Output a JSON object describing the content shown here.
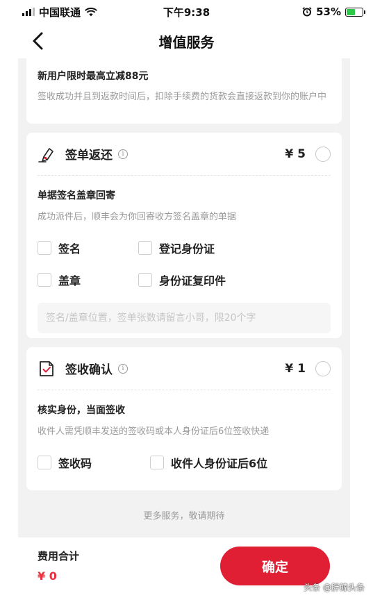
{
  "status_bar": {
    "carrier": "中国联通",
    "time": "下午9:38",
    "battery_percent": "53%",
    "battery_level": 0.53,
    "icons": [
      "signal-icon",
      "wifi-icon",
      "alarm-icon",
      "battery-icon"
    ]
  },
  "nav": {
    "title": "增值服务",
    "back_icon": "chevron-left-icon"
  },
  "promo": {
    "title": "新用户限时最高立减88元",
    "desc": "签收成功并且到返款时间后，扣除手续费的货款会直接返款到你的账户中"
  },
  "sign_return": {
    "name": "签单返还",
    "icon": "pen-sign-icon",
    "price": "¥ 5",
    "selected": false,
    "sub_title": "单据签名盖章回寄",
    "sub_desc": "成功派件后，顺丰会为你回寄收方签名盖章的单据",
    "options": [
      {
        "label": "签名",
        "checked": false
      },
      {
        "label": "登记身份证",
        "checked": false
      },
      {
        "label": "盖章",
        "checked": false
      },
      {
        "label": "身份证复印件",
        "checked": false
      }
    ],
    "note_placeholder": "签名/盖章位置，签单张数请留言小哥，限20个字",
    "note_value": ""
  },
  "sign_confirm": {
    "name": "签收确认",
    "icon": "checked-document-icon",
    "price": "¥ 1",
    "selected": false,
    "sub_title": "核实身份，当面签收",
    "sub_desc": "收件人需凭顺丰发送的签收码或本人身份证后6位签收快递",
    "options": [
      {
        "label": "签收码",
        "checked": false
      },
      {
        "label": "收件人身份证后6位",
        "checked": false
      }
    ]
  },
  "more_hint": "更多服务，敬请期待",
  "footer": {
    "total_label": "费用合计",
    "total_value": "¥ 0",
    "confirm_label": "确定"
  },
  "watermark": "头条 @胖鲸头条",
  "colors": {
    "accent": "#e01f34",
    "price_red": "#e8303f",
    "panel_bg": "#f2f2f2",
    "muted_text": "#9a9a9a"
  }
}
